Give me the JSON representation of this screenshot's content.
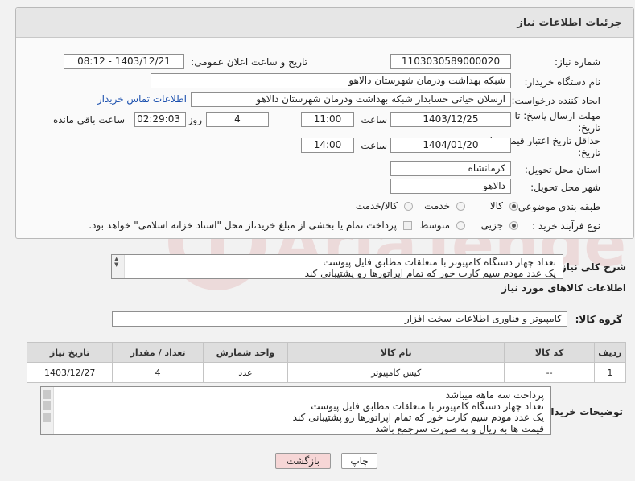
{
  "panel": {
    "title": "جزئیات اطلاعات نیاز"
  },
  "fields": {
    "need_number_label": "شماره نیاز:",
    "need_number": "1103030589000020",
    "announce_label": "تاریخ و ساعت اعلان عمومی:",
    "announce_value": "1403/12/21 - 08:12",
    "buyer_org_label": "نام دستگاه خریدار:",
    "buyer_org": "شبکه بهداشت ودرمان شهرستان دالاهو",
    "creator_label": "ایجاد کننده درخواست:",
    "creator": "ارسلان حیاتی حسابدار شبکه بهداشت ودرمان شهرستان دالاهو",
    "contact_link": "اطلاعات تماس خریدار",
    "reply_deadline_label_1": "مهلت ارسال پاسخ: تا",
    "reply_deadline_label_2": "تاریخ:",
    "reply_date": "1403/12/25",
    "time_label": "ساعت",
    "reply_time": "11:00",
    "days": "4",
    "days_label": "روز و",
    "remaining_time": "02:29:03",
    "remaining_label": "ساعت باقی مانده",
    "min_validity_label_1": "حداقل تاریخ اعتبار قیمت: تا",
    "min_validity_label_2": "تاریخ:",
    "validity_date": "1404/01/20",
    "validity_time": "14:00",
    "province_label": "استان محل تحویل:",
    "province": "کرمانشاه",
    "city_label": "شهر محل تحویل:",
    "city": "دالاهو",
    "category_label": "طبقه بندی موضوعی:",
    "category_options": [
      "کالا",
      "خدمت",
      "کالا/خدمت"
    ],
    "process_label": "نوع فرآیند خرید :",
    "process_options": [
      "جزیی",
      "متوسط"
    ],
    "payment_note": "پرداخت تمام یا بخشی از مبلغ خرید،از محل \"اسناد خزانه اسلامی\" خواهد بود."
  },
  "description": {
    "label": "شرح کلی نیاز:",
    "lines": [
      "تعداد چهار دستگاه کامپیوتر با متعلقات مطابق فایل پیوست",
      "یک عدد مودم سیم کارت خور که تمام اپراتورها رو پشتیبانی کند"
    ]
  },
  "goods_section": {
    "title": "اطلاعات کالاهای مورد نیاز",
    "group_label": "گروه کالا:",
    "group_value": "کامپیوتر و فناوری اطلاعات-سخت افزار"
  },
  "table": {
    "headers": [
      "ردیف",
      "کد کالا",
      "نام کالا",
      "واحد شمارش",
      "تعداد / مقدار",
      "تاریخ نیاز"
    ],
    "rows": [
      [
        "1",
        "--",
        "کیس کامپیوتر",
        "عدد",
        "4",
        "1403/12/27"
      ]
    ]
  },
  "buyer_notes": {
    "label": "توضیحات خریدار:",
    "lines": [
      "پرداخت سه ماهه میباشد",
      "تعداد چهار دستگاه کامپیوتر با متعلقات مطابق فایل پیوست",
      "یک عدد مودم سیم کارت خور که تمام اپراتورها رو پشتیبانی کند",
      "قیمت ها به ریال و به صورت سرجمع باشد"
    ]
  },
  "buttons": {
    "print": "چاپ",
    "back": "بازگشت"
  },
  "watermark": {
    "text": "AriaTender.net"
  },
  "colors": {
    "link": "#1a4fae",
    "back_button_bg": "#f6d6d6",
    "print_button_bg": "#ffffff"
  }
}
